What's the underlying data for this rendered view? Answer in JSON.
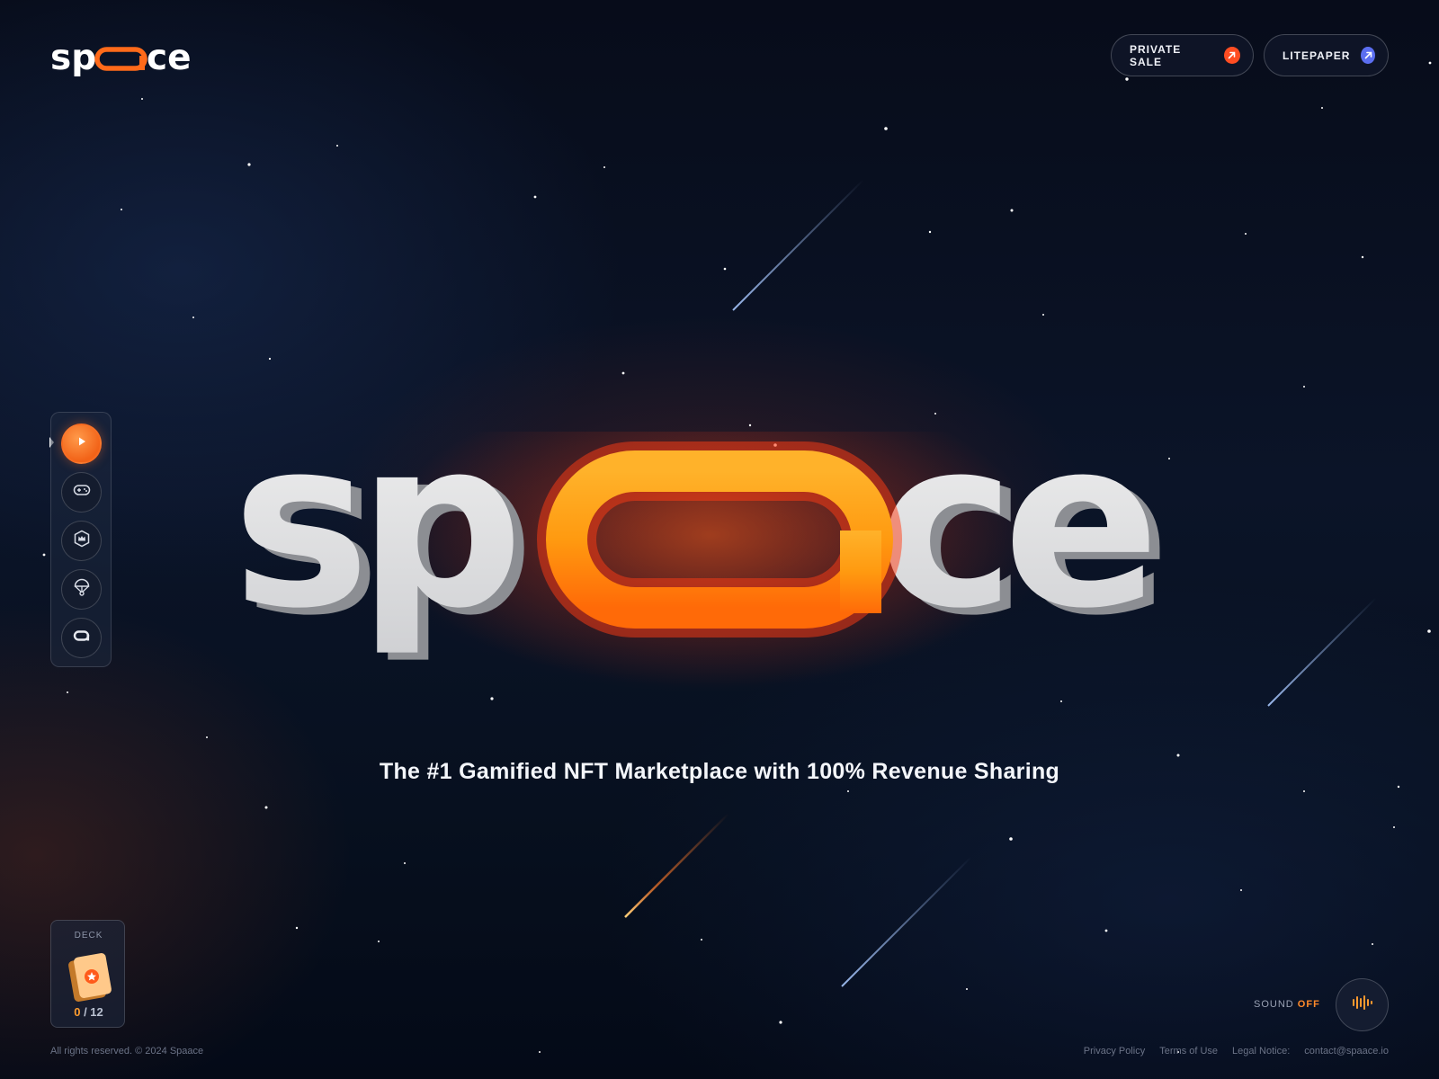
{
  "brand": {
    "name": "spaace",
    "accent": "#ff6a1a"
  },
  "header": {
    "private_sale_label": "PRIVATE SALE",
    "litepaper_label": "LITEPAPER",
    "private_sale_icon": "arrow-up-right-icon",
    "litepaper_icon": "arrow-up-right-icon",
    "private_sale_color": "#ff4d22",
    "litepaper_color": "#5b6ef0"
  },
  "sidenav": {
    "items": [
      {
        "icon": "play-icon",
        "active": true
      },
      {
        "icon": "gamepad-icon",
        "active": false
      },
      {
        "icon": "crown-shield-icon",
        "active": false
      },
      {
        "icon": "parachute-icon",
        "active": false
      },
      {
        "icon": "spaace-a-icon",
        "active": false
      }
    ]
  },
  "hero": {
    "wordmark": "spaace",
    "tagline": "The #1 Gamified NFT Marketplace with 100% Revenue Sharing"
  },
  "deck": {
    "label": "DECK",
    "current": "0",
    "total": "/ 12"
  },
  "sound": {
    "label": "SOUND",
    "state": "OFF"
  },
  "footer": {
    "copyright": "All rights reserved. © 2024 Spaace",
    "links": [
      "Privacy Policy",
      "Terms of Use",
      "Legal Notice:",
      "contact@spaace.io"
    ]
  }
}
